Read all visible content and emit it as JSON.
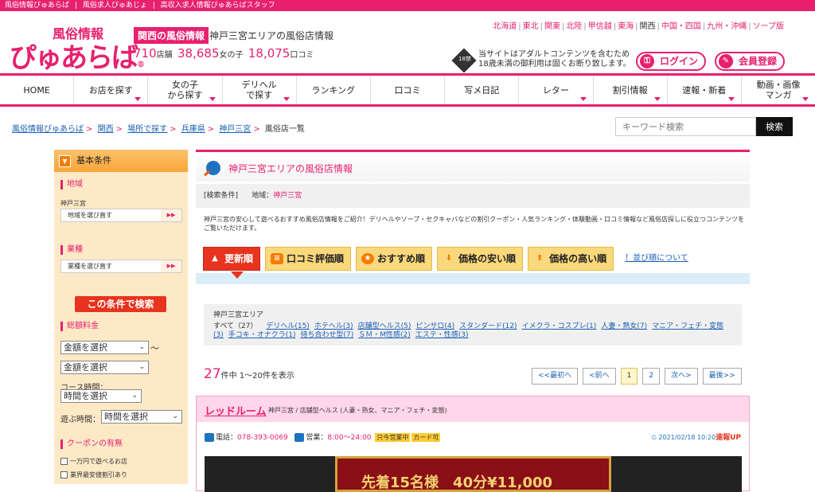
{
  "topbar": {
    "items": [
      "風俗情報ぴゅあらば",
      "|",
      "風俗求人ぴゅあじょ",
      "|",
      "高収入求人情報ぴゅあらばスタッフ"
    ]
  },
  "logo": {
    "small": "風俗情報",
    "big": "ぴゅあらば",
    "mark": "®"
  },
  "header": {
    "region_badge": "関西の風俗情報",
    "region_title": "神戸三宮エリアの風俗店情報",
    "stats": {
      "shops": "710",
      "shops_unit": "店舗",
      "girls": "38,685",
      "girls_unit": "女の子",
      "reviews": "18,075",
      "reviews_unit": "口コミ"
    },
    "regions": [
      "北海道",
      "東北",
      "関東",
      "北陸",
      "甲信越",
      "東海",
      "関西",
      "中国・四国",
      "九州・沖縄",
      "ソープ版"
    ],
    "current_region": "関西",
    "age_note_1": "当サイトはアダルトコンテンツを含むため",
    "age_note_2": "18歳未満の御利用は固くお断り致します。",
    "age_icon": "18禁",
    "login": "ログイン",
    "register": "会員登録"
  },
  "nav": [
    {
      "label": "HOME",
      "dropdown": false
    },
    {
      "label": "お店を探す",
      "dropdown": true
    },
    {
      "label": "女の子\nから探す",
      "dropdown": true
    },
    {
      "label": "デリヘル\nで探す",
      "dropdown": true
    },
    {
      "label": "ランキング",
      "dropdown": false
    },
    {
      "label": "口コミ",
      "dropdown": false
    },
    {
      "label": "写メ日記",
      "dropdown": false
    },
    {
      "label": "レター",
      "dropdown": true
    },
    {
      "label": "割引情報",
      "dropdown": true
    },
    {
      "label": "速報・新着",
      "dropdown": true
    },
    {
      "label": "動画・画像\nマンガ",
      "dropdown": true
    }
  ],
  "breadcrumb": [
    "風俗情報ぴゅあらば",
    "関西",
    "場所で探す",
    "兵庫県",
    "神戸三宮",
    "風俗店一覧"
  ],
  "search": {
    "placeholder": "キーワード検索",
    "button": "検索"
  },
  "sidebar": {
    "head": "基本条件",
    "area_label": "地域",
    "area_value": "神戸三宮",
    "area_button": "地域を選び直す",
    "type_label": "業種",
    "type_button": "業種を選び直す",
    "search_button": "この条件で検索",
    "price_label": "総額料金",
    "price_select_1": "金額を選択",
    "price_tilde": "〜",
    "price_select_2": "金額を選択",
    "course_label": "コース時間：",
    "course_select": "時間を選択",
    "play_label": "遊ぶ時間：",
    "play_select": "時間を選択",
    "coupon_label": "クーポンの有無",
    "coupon_1": "一万円で遊べるお店",
    "coupon_2": "業界最安値割引あり"
  },
  "main": {
    "title": "神戸三宮エリアの風俗店情報",
    "cond_label": "[検索条件]",
    "cond_area": "地域：",
    "cond_area_value": "神戸三宮",
    "desc": "神戸三宮の安心して遊べるおすすめ風俗店情報をご紹介！デリヘルやソープ・セクキャバなどの割引クーポン・人気ランキング・体験動画・口コミ情報など風俗店探しに役立つコンテンツをご覧いただけます。",
    "tabs": [
      "更新順",
      "口コミ評価順",
      "おすすめ順",
      "価格の安い順",
      "価格の高い順"
    ],
    "tab_link": "！並び順について",
    "area_title": "神戸三宮エリア",
    "area_all": "すべて（27）",
    "area_links": [
      "デリヘル(15)",
      "ホテヘル(3)",
      "店舗型ヘルス(5)",
      "ピンサロ(4)",
      "スタンダード(12)",
      "イメクラ・コスプレ(1)",
      "人妻・熟女(7)",
      "マニア・フェチ・変態(3)",
      "手コキ・オナクラ(1)",
      "待ち合わせ型(7)",
      "ＳＭ・M性感(2)",
      "エステ・性感(3)"
    ],
    "count_num": "27",
    "count_text": "件中 1〜20件を表示",
    "pager": [
      "<<最初へ",
      "<前へ",
      "1",
      "2",
      "次へ>",
      "最後>>"
    ]
  },
  "shop": {
    "name": "レッドルーム",
    "sub": "神戸三宮 / 店舗型ヘルス (人妻・熟女、マニア・フェチ・変態)",
    "tel_label": "電話：",
    "tel": "078-393-0069",
    "hours_label": "営業：",
    "hours": "8:00〜24:00",
    "tag_1": "只今営業中",
    "tag_2": "カード可",
    "date": "2021/02/18 10:20",
    "date_badge": "速報UP",
    "banner_text": "先着15名様　40分¥11,000"
  }
}
